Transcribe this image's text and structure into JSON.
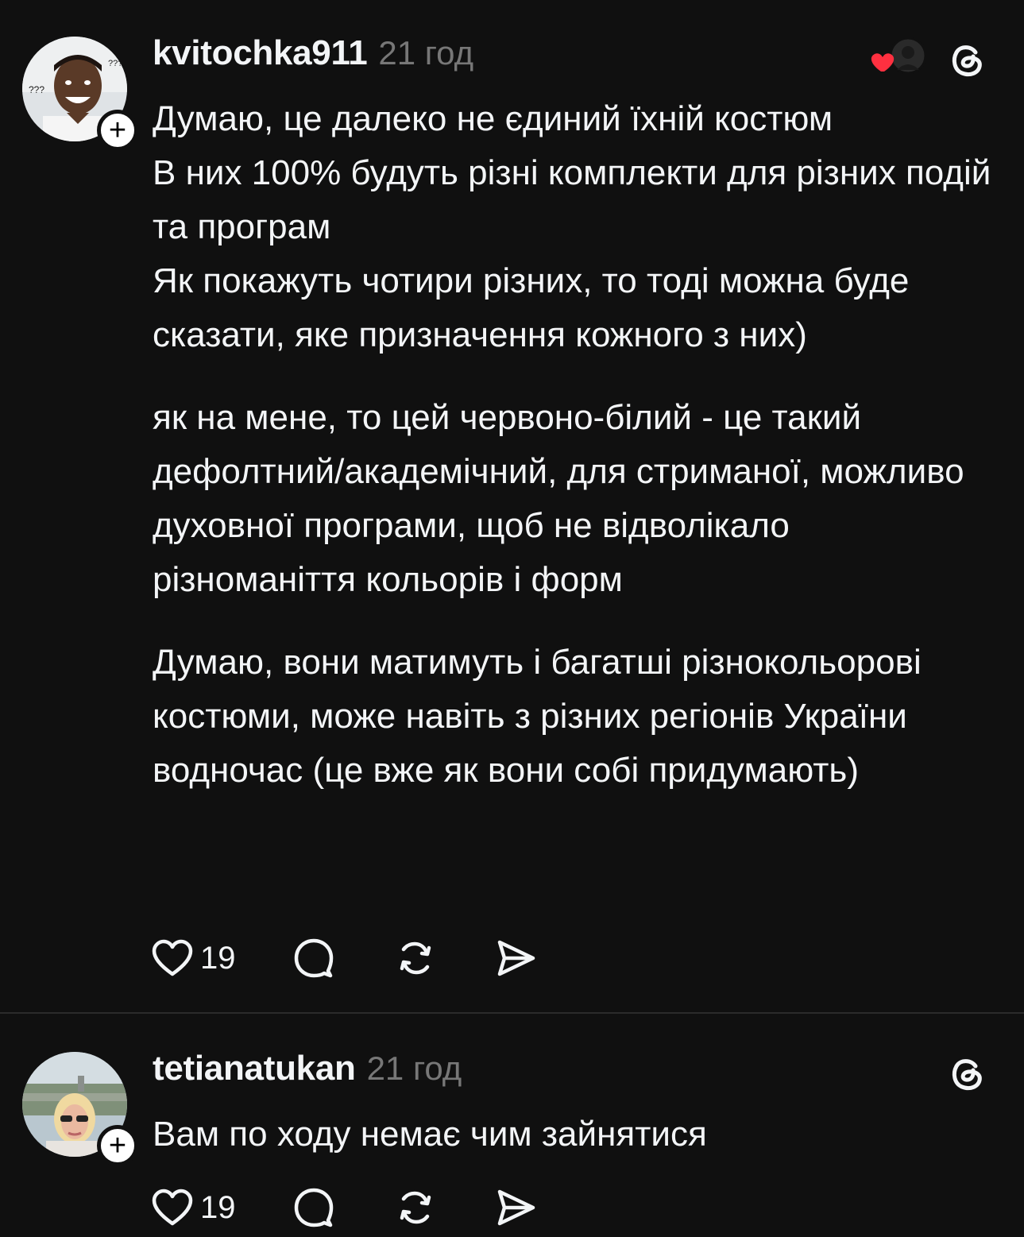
{
  "posts": [
    {
      "username": "kvitochka911",
      "time": "21 год",
      "lines": [
        "Думаю, це далеко не єдиний їхній костюм",
        "В них 100% будуть різні комплекти для різних подій та програм",
        "Як покажуть чотири різних, то тоді можна буде сказати, яке призначення кожного з них)"
      ],
      "paragraph2": "як на мене, то цей червоно-білий - це такий дефолтний/академічний, для стриманої, можливо духовної програми, щоб не відволікало різноманіття кольорів і форм",
      "paragraph3": "Думаю, вони матимуть і багатші різнокольорові костюми, може навіть з різних регіонів України водночас (це вже як вони собі придумають)",
      "likes": "19",
      "liked_by_author": true,
      "avatar_icon": "meme-face-avatar",
      "avatar_text": "???"
    },
    {
      "username": "tetianatukan",
      "time": "21 год",
      "text": "Вам по ходу немає чим зайнятися",
      "likes": "19",
      "avatar_icon": "woman-sunglasses-avatar"
    }
  ],
  "icons": {
    "like": "heart-outline-icon",
    "reply": "speech-bubble-icon",
    "repost": "repost-arrows-icon",
    "share": "paper-plane-icon",
    "threads": "threads-logo-icon",
    "follow": "plus-icon",
    "author_liked": "red-heart-icon"
  },
  "colors": {
    "background": "#101010",
    "text": "#f3f5f7",
    "muted": "#777777",
    "heart": "#ff3040",
    "divider": "#2b2b2b"
  }
}
